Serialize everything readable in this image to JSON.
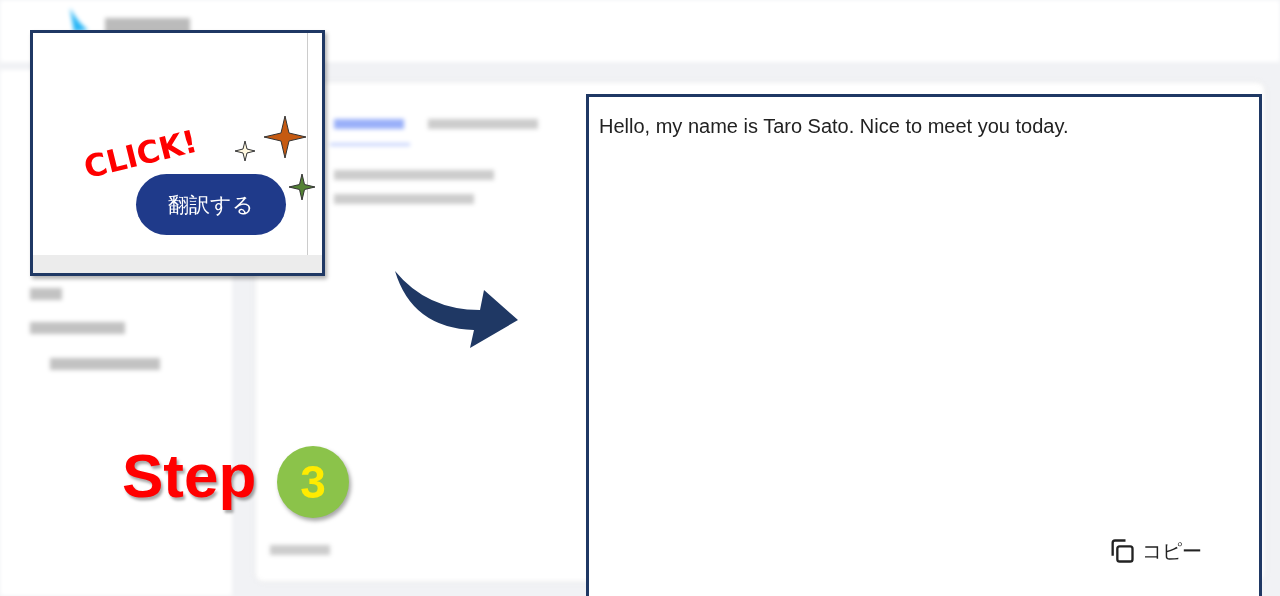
{
  "callout": {
    "annotation": "CLICK!",
    "button": "翻訳する"
  },
  "step": {
    "label": "Step",
    "number": "3"
  },
  "output": {
    "text": "Hello, my name is Taro Sato. Nice to meet you today.",
    "copy_button": "コピー"
  }
}
